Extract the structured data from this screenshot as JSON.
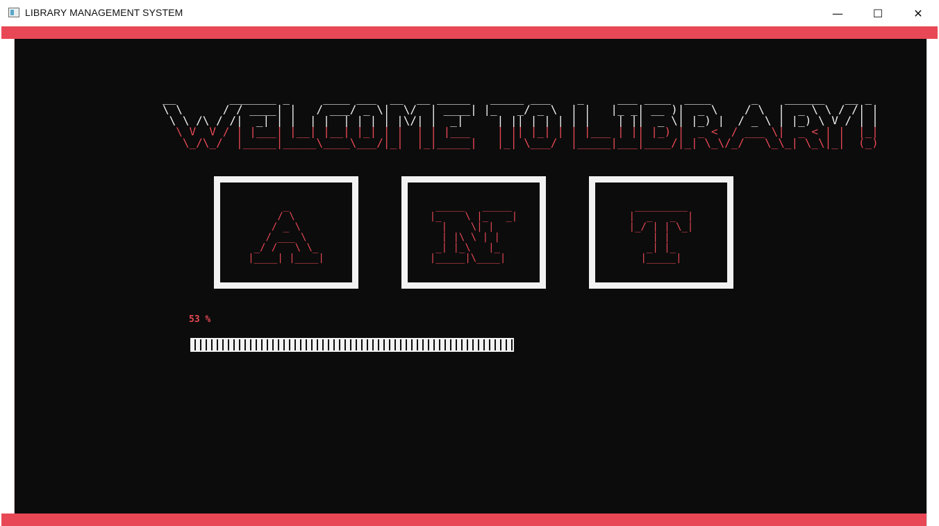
{
  "window": {
    "title": "LIBRARY MANAGEMENT SYSTEM",
    "minimize_glyph": "—",
    "maximize_glyph": "☐",
    "close_glyph": "✕"
  },
  "colors": {
    "accent": "#e84855",
    "console_bg": "#0c0c0c",
    "text_white": "#f2f2f2"
  },
  "banner": {
    "line1": "__        _______ _     ____ ___  __  __ _____   _____ ___    _     ___ ____  ____      _    ______   __ _",
    "line2": "\\ \\      / / ____| |   / ___/ _ \\|  \\/  | ____| |_   _/ _ \\  | |   |_ _| __ )|  _ \\    / \\  |  _ \\ \\ / /| |",
    "line3": " \\ \\ /\\ / /|  _| | |  | |  | | | | |\\/| |  _|     | || | | | | |    | ||  _ \\| |_) |  / _ \\ | |_) \\ V / | |",
    "line4": "  \\ V  V / | |___| |__| |__| |_| | |  | | |___    | || |_| | | |___ | || |_) |  _ <  / ___ \\|  _ < | |  |_|",
    "line5": "   \\_/\\_/  |_____|_____\\____\\___/|_|  |_|_____|   |_| \\___/  |_____|___|____/|_| \\_\\/_/   \\_\\_| \\_\\|_|  (_)"
  },
  "letters": {
    "a": "      _\n     / \\\n    / _ \\\n   / ___ \\\n _/ /   \\ \\_\n|____| |____|",
    "n": " _____   _____\n|_    \\ |_   _|\n  |    \\| |\n  | |\\ \\ | |\n _| |_\\   |_\n|_____|\\____|",
    "t": " _________\n|  _   _  |\n|_/ | | \\_|\n    | |\n   _| |_\n  |_____|"
  },
  "progress": {
    "label": "53 %",
    "value": 0.53
  }
}
